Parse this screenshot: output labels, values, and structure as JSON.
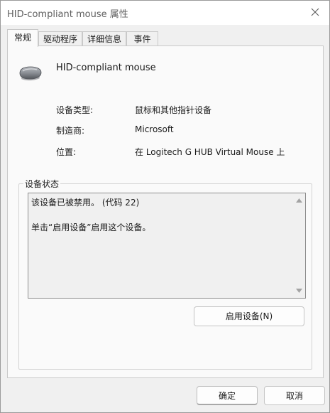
{
  "window": {
    "title": "HID-compliant mouse 属性"
  },
  "tabs": [
    {
      "label": "常规",
      "active": true
    },
    {
      "label": "驱动程序",
      "active": false
    },
    {
      "label": "详细信息",
      "active": false
    },
    {
      "label": "事件",
      "active": false
    }
  ],
  "device": {
    "icon": "mouse-icon",
    "name": "HID-compliant mouse",
    "properties": [
      {
        "label": "设备类型:",
        "value": "鼠标和其他指针设备"
      },
      {
        "label": "制造商:",
        "value": "Microsoft"
      },
      {
        "label": "位置:",
        "value": "在 Logitech G HUB Virtual Mouse 上"
      }
    ]
  },
  "status_group": {
    "legend": "设备状态",
    "lines": [
      "该设备已被禁用。 (代码 22)",
      "单击“启用设备”启用这个设备。"
    ],
    "enable_button": "启用设备(N)"
  },
  "footer": {
    "ok_label": "确定",
    "cancel_label": "取消"
  }
}
